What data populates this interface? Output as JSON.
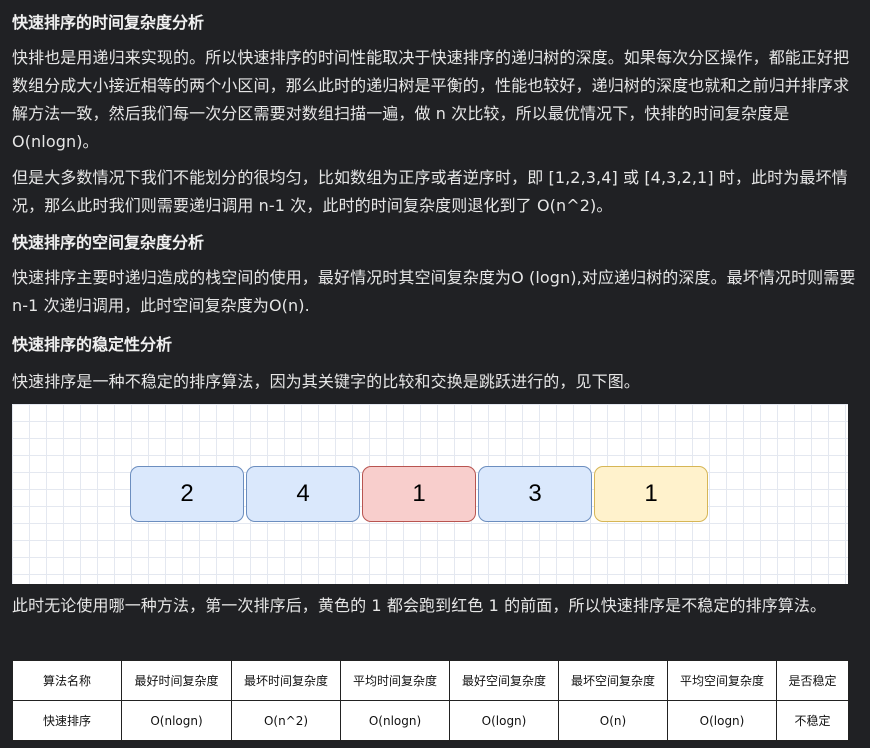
{
  "section1": {
    "title": "快速排序的时间复杂度分析",
    "para1": "快排也是用递归来实现的。所以快速排序的时间性能取决于快速排序的递归树的深度。如果每次分区操作，都能正好把数组分成大小接近相等的两个小区间，那么此时的递归树是平衡的，性能也较好，递归树的深度也就和之前归并排序求解方法一致，然后我们每一次分区需要对数组扫描一遍，做 n 次比较，所以最优情况下，快排的时间复杂度是 O(nlogn)。",
    "para2": "但是大多数情况下我们不能划分的很均匀，比如数组为正序或者逆序时，即 [1,2,3,4] 或 [4,3,2,1] 时，此时为最坏情况，那么此时我们则需要递归调用 n-1 次，此时的时间复杂度则退化到了 O(n^2)。"
  },
  "section2": {
    "title": "快速排序的空间复杂度分析",
    "para1": "快速排序主要时递归造成的栈空间的使用，最好情况时其空间复杂度为O (logn),对应递归树的深度。最坏情况时则需要 n-1 次递归调用，此时空间复杂度为O(n)."
  },
  "section3": {
    "title": "快速排序的稳定性分析",
    "para1": "快速排序是一种不稳定的排序算法，因为其关键字的比较和交换是跳跃进行的，见下图。",
    "para2": "此时无论使用哪一种方法，第一次排序后，黄色的 1 都会跑到红色 1 的前面，所以快速排序是不稳定的排序算法。"
  },
  "diagram": {
    "boxes": [
      {
        "value": "2",
        "color": "#dae8fc"
      },
      {
        "value": "4",
        "color": "#dae8fc"
      },
      {
        "value": "1",
        "color": "#f8cecc"
      },
      {
        "value": "3",
        "color": "#dae8fc"
      },
      {
        "value": "1",
        "color": "#fff2cc"
      }
    ]
  },
  "table": {
    "headers": [
      "算法名称",
      "最好时间复杂度",
      "最坏时间复杂度",
      "平均时间复杂度",
      "最好空间复杂度",
      "最坏空间复杂度",
      "平均空间复杂度",
      "是否稳定"
    ],
    "row": [
      "快速排序",
      "O(nlogn)",
      "O(n^2)",
      "O(nlogn)",
      "O(logn)",
      "O(n)",
      "O(logn)",
      "不稳定"
    ]
  }
}
